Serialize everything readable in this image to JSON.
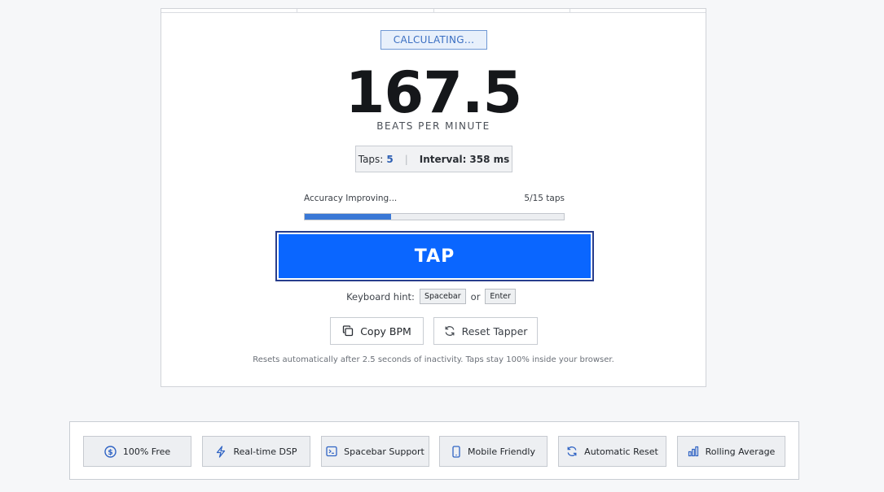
{
  "status": {
    "label": "CALCULATING..."
  },
  "readout": {
    "bpm": "167.5",
    "unit": "BEATS PER MINUTE"
  },
  "stats": {
    "taps_label": "Taps:",
    "taps_value": "5",
    "divider": "|",
    "interval_label": "Interval:",
    "interval_value": "358 ms"
  },
  "accuracy": {
    "label": "Accuracy Improving...",
    "count": "5/15 taps",
    "progress_fraction": 0.3333
  },
  "tap_button": {
    "label": "TAP"
  },
  "keyboard_hint": {
    "label": "Keyboard hint:",
    "key1": "Spacebar",
    "separator": "or",
    "key2": "Enter"
  },
  "actions": {
    "copy_label": "Copy BPM",
    "copy_icon": "copy-icon",
    "reset_label": "Reset Tapper",
    "reset_icon": "refresh-icon"
  },
  "footnote": "Resets automatically after 2.5 seconds of inactivity. Taps stay 100% inside your browser.",
  "features": [
    {
      "label": "100% Free",
      "icon": "dollar-icon"
    },
    {
      "label": "Real-time DSP",
      "icon": "bolt-icon"
    },
    {
      "label": "Spacebar Support",
      "icon": "terminal-icon"
    },
    {
      "label": "Mobile Friendly",
      "icon": "phone-icon"
    },
    {
      "label": "Automatic Reset",
      "icon": "refresh-icon"
    },
    {
      "label": "Rolling Average",
      "icon": "bar-chart-icon"
    }
  ],
  "colors": {
    "accent": "#0a66ff",
    "progress": "#3a78d6",
    "icon_blue": "#2f63c4"
  }
}
